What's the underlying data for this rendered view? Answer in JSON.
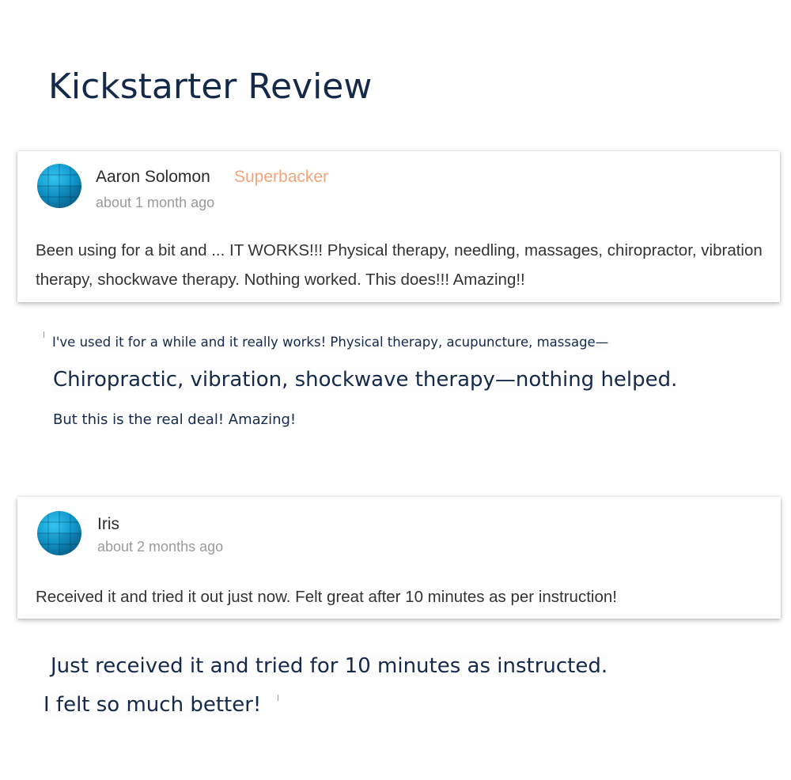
{
  "page": {
    "title": "Kickstarter Review"
  },
  "reviews": [
    {
      "name": "Aaron Solomon",
      "badge": "Superbacker",
      "timestamp": "about 1 month ago",
      "body": "Been using for a bit and ... IT WORKS!!! Physical therapy, needling, massages, chiropractor, vibration therapy, shockwave therapy. Nothing worked. This does!!! Amazing!!",
      "translation": [
        "I've used it for a while and it really works! Physical therapy, acupuncture, massage—",
        "Chiropractic, vibration, shockwave therapy—nothing helped.",
        "But this is the real deal! Amazing!"
      ]
    },
    {
      "name": "Iris",
      "timestamp": "about 2 months ago",
      "body": "Received it and tried it out just now. Felt great after 10 minutes as per instruction!",
      "translation": [
        "Just received it and tried for 10 minutes as instructed.",
        "I felt so much better!"
      ]
    }
  ],
  "icons": {
    "avatar": "default-avatar-icon"
  },
  "colors": {
    "title": "#15294b",
    "badge": "#f0a57a",
    "timestamp": "#9a9a9a",
    "body_text": "#333333",
    "avatar": "#129bd0"
  }
}
